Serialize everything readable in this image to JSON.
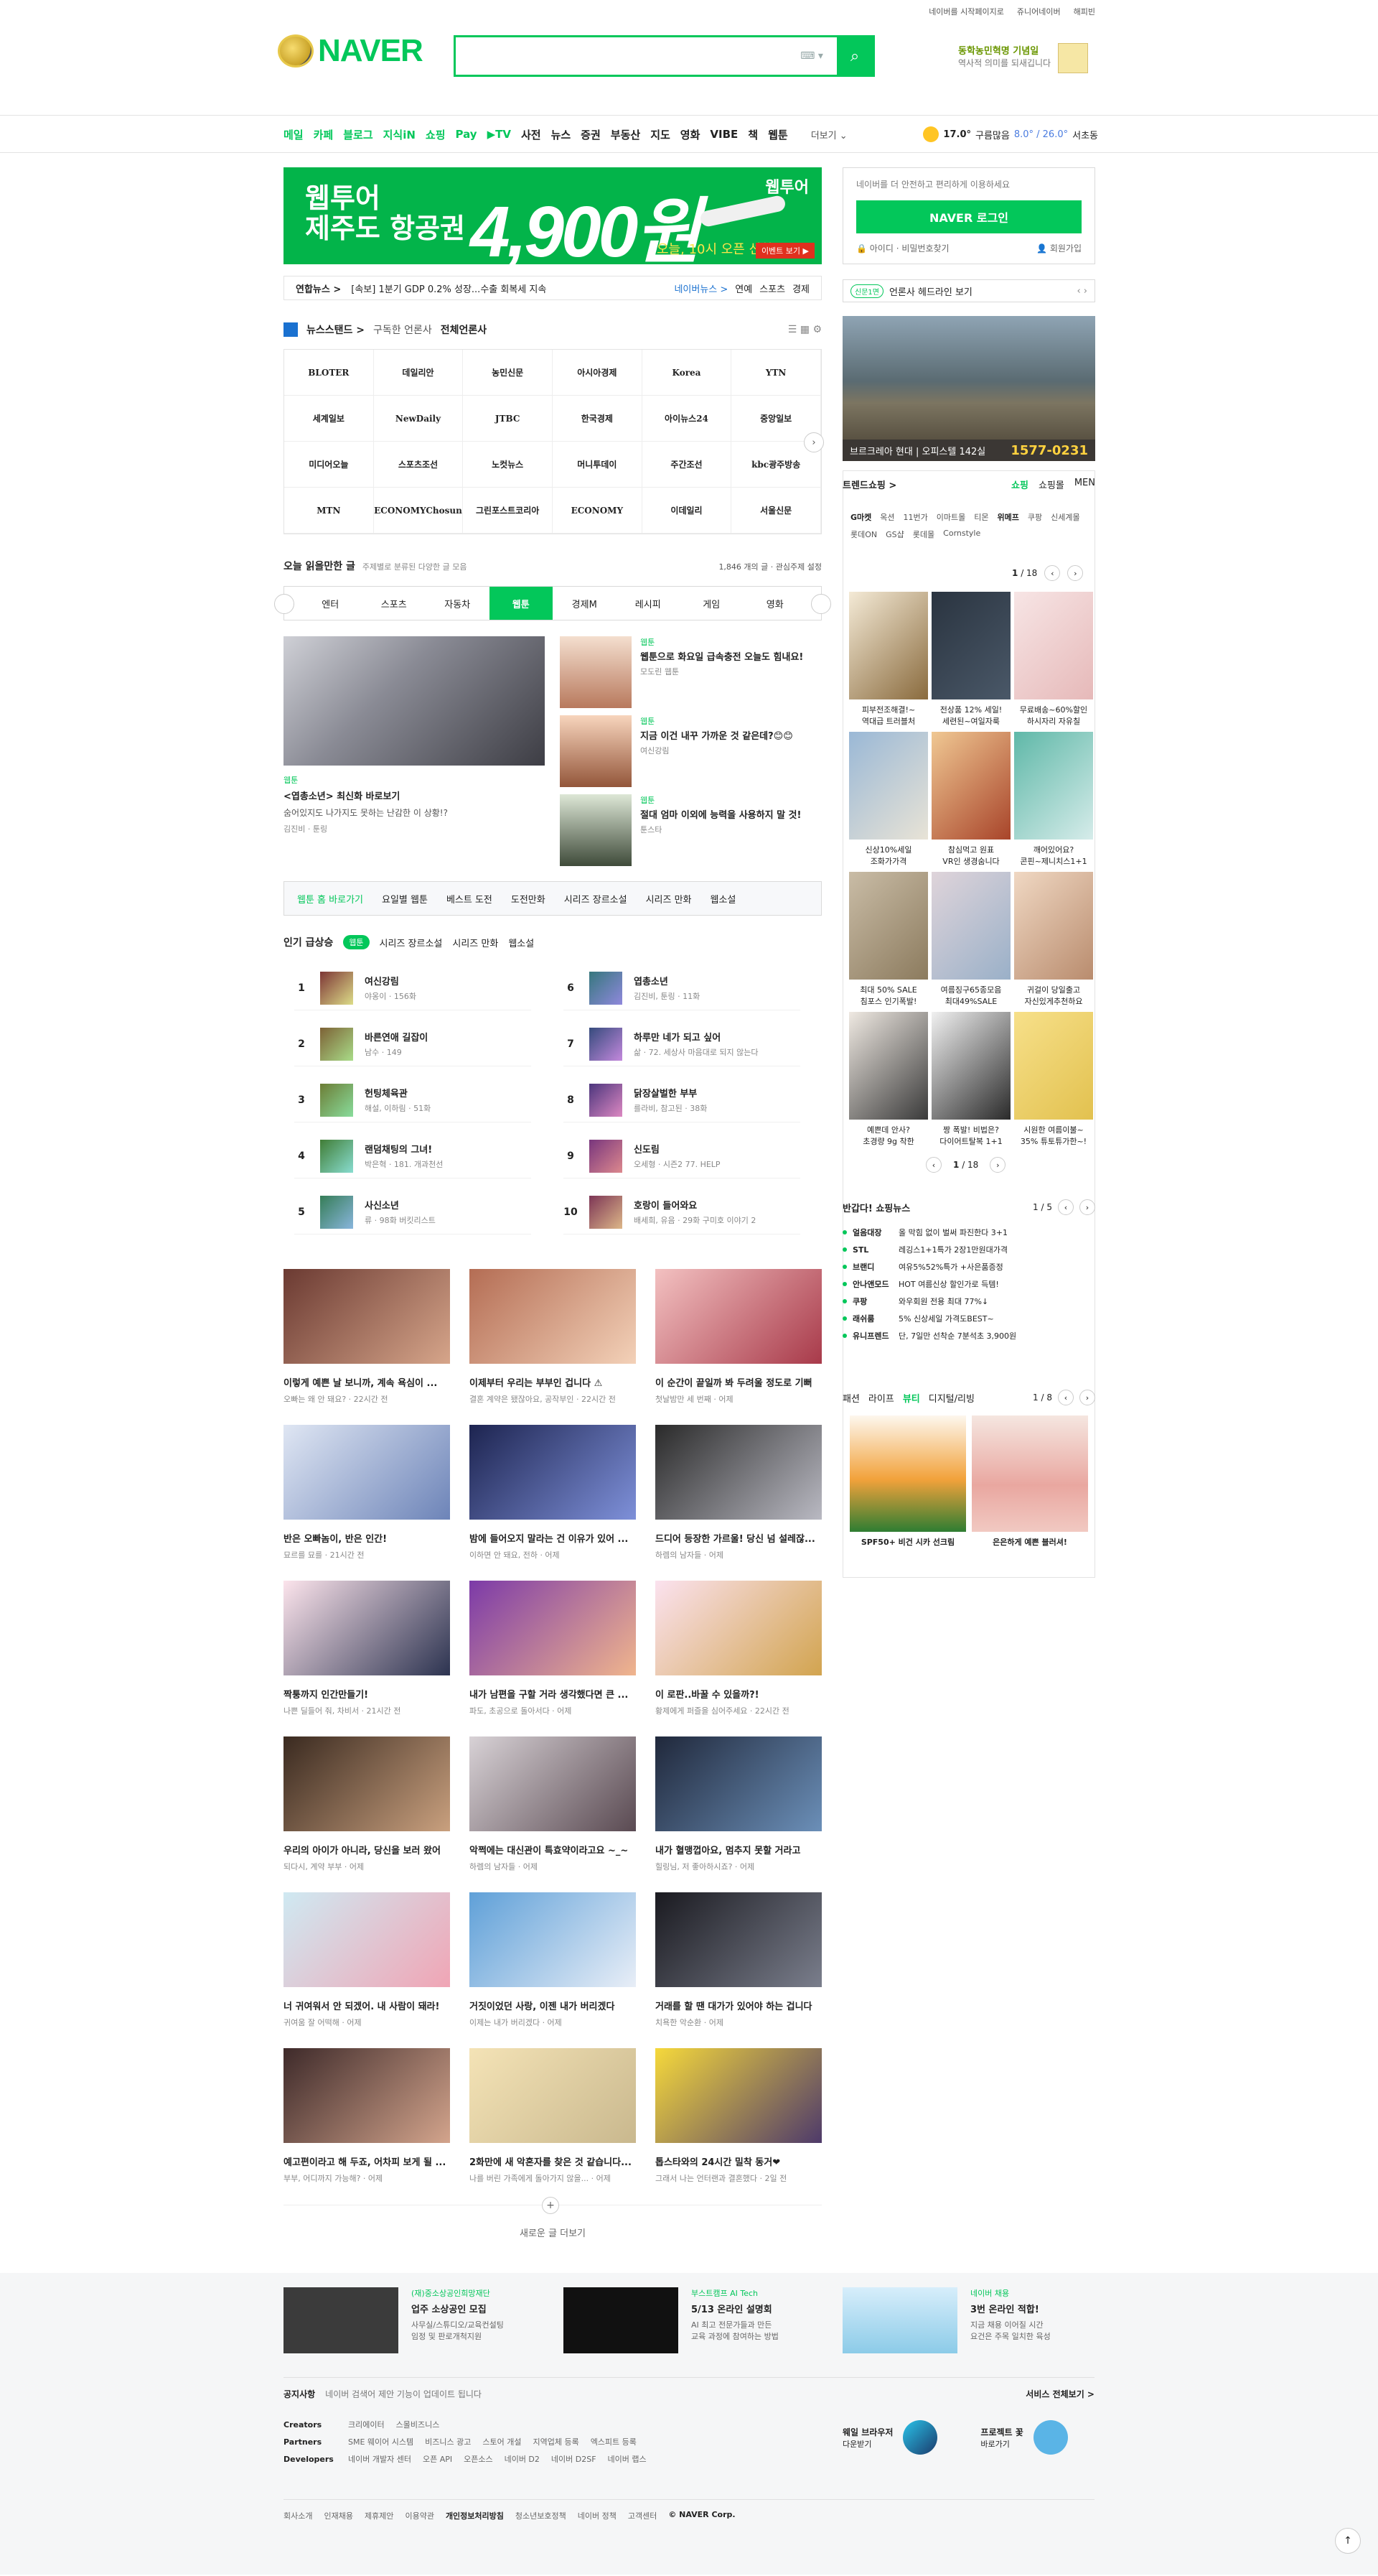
{
  "util": {
    "start": "네이버를 시작페이지로",
    "jr": "쥬니어네이버",
    "happy": "해피빈"
  },
  "logo": "NAVER",
  "search": {
    "placeholder": "",
    "kbd": "⌨ ▾"
  },
  "promo": {
    "line1": "동학농민혁명 기념일",
    "line2": "역사적 의미를 되새깁니다"
  },
  "gnb": {
    "items": [
      "메일",
      "카페",
      "블로그",
      "지식iN",
      "쇼핑",
      "Pay",
      "▶TV",
      "사전",
      "뉴스",
      "증권",
      "부동산",
      "지도",
      "영화",
      "VIBE",
      "책",
      "웹툰"
    ],
    "more": "더보기 ⌄",
    "weather": {
      "temp": "17.0°",
      "desc": "구름많음",
      "range": "8.0° / 26.0°",
      "loc": "서초동"
    }
  },
  "ad": {
    "line1": "웹투어",
    "line2": "제주도 항공권",
    "price": "4,900원",
    "brand": "웹투어",
    "sub": "오늘, 10시 오픈 선착순",
    "cta": "이벤트 보기 ▶"
  },
  "newsbar": {
    "src": "연합뉴스 >",
    "headline": "[속보] 1분기 GDP 0.2% 성장...수출 회복세 지속",
    "r1": "네이버뉴스 >",
    "r2": "연예",
    "r3": "스포츠",
    "r4": "경제"
  },
  "login": {
    "msg": "네이버를 더 안전하고 편리하게 이용하세요",
    "btn": "NAVER 로그인",
    "find": "🔒 아이디 · 비밀번호찾기",
    "join": "👤 회원가입"
  },
  "press": {
    "badge": "신문1면",
    "text": "언론사 헤드라인 보기",
    "arr": "‹  ›"
  },
  "newsstand": {
    "title": "뉴스스탠드 >",
    "sub1": "구독한 언론사",
    "sub2": "전체언론사",
    "tools": "☰  ▦  ⚙",
    "logos": [
      "BLOTER",
      "데일리안",
      "농민신문",
      "아시아경제",
      "Korea",
      "YTN",
      "세계일보",
      "NewDaily",
      "JTBC",
      "한국경제",
      "아이뉴스24",
      "중앙일보",
      "미디어오늘",
      "스포츠조선",
      "노컷뉴스",
      "머니투데이",
      "주간조선",
      "kbc광주방송",
      "MTN",
      "ECONOMYChosun",
      "그린포스트코리아",
      "ECONOMY",
      "이데일리",
      "서울신문"
    ]
  },
  "rec": {
    "title": "오늘 읽을만한 글",
    "sub": "주제별로 분류된 다양한 글 모음",
    "count": "1,846 개의 글",
    "set": "관심주제 설정"
  },
  "tabs": [
    "엔터",
    "스포츠",
    "자동차",
    "웹툰",
    "경제M",
    "레시피",
    "게임",
    "영화"
  ],
  "main": {
    "tag": "웹툰",
    "title": "<엽총소년> 최신화 바로보기",
    "desc": "숨어있지도 나가지도 못하는 난감한 이 상황!?",
    "author": "김진비 · 툰링"
  },
  "side": [
    {
      "tag": "웹툰",
      "title": "웹툰으로 화요일 급속충전 오늘도 힘내요!",
      "author": "모도린 웹툰"
    },
    {
      "tag": "웹툰",
      "title": "지금 이건 내꾸 가까운 것 같은데?😊😊",
      "author": "여신강림"
    },
    {
      "tag": "웹툰",
      "title": "절대 엄마 이외에 능력을 사용하지 말 것!",
      "author": "툰스타"
    }
  ],
  "webtoonTabs": [
    "웹툰 홈 바로가기",
    "요일별 웹툰",
    "베스트 도전",
    "도전만화",
    "시리즈 장르소설",
    "시리즈 만화",
    "웹소설"
  ],
  "pop": {
    "title": "인기 급상승",
    "tabs": [
      "웹툰",
      "시리즈 장르소설",
      "시리즈 만화",
      "웹소설"
    ]
  },
  "ranks": [
    {
      "n": "1",
      "t": "여신강림",
      "s": "야옹이 · 156화"
    },
    {
      "n": "2",
      "t": "바른연애 길잡이",
      "s": "남수 · 149"
    },
    {
      "n": "3",
      "t": "헌팅체육관",
      "s": "해설, 이하림 · 51화"
    },
    {
      "n": "4",
      "t": "랜덤채팅의 그녀!",
      "s": "박은혁 · 181. 개과천선"
    },
    {
      "n": "5",
      "t": "사신소년",
      "s": "류 · 98화 버킷리스트"
    },
    {
      "n": "6",
      "t": "엽총소년",
      "s": "김진비, 툰링 · 11화"
    },
    {
      "n": "7",
      "t": "하루만 네가 되고 싶어",
      "s": "삶 · 72. 세상사 마음대로 되지 않는다"
    },
    {
      "n": "8",
      "t": "닭장살벌한 부부",
      "s": "를라비, 참고된 · 38화"
    },
    {
      "n": "9",
      "t": "신도림",
      "s": "오세형 · 시즌2 77. HELP"
    },
    {
      "n": "10",
      "t": "호랑이 들어와요",
      "s": "배세희, 유음 · 29화 구미호 이야기 2"
    }
  ],
  "cards": [
    {
      "t": "이렇게 예쁜 날 보니까, 계속 욕심이 ...",
      "s": "오빠는 왜 안 돼요? · 22시간 전"
    },
    {
      "t": "이제부터 우리는 부부인 겁니다 ⚠",
      "s": "결혼 계약은 됐잖아요, 공작부인 · 22시간 전"
    },
    {
      "t": "이 순간이 끝일까 봐 두려울 정도로 기뻐",
      "s": "첫날밤만 세 번째 · 어제"
    },
    {
      "t": "반은 오빠놈이, 반은 인간!",
      "s": "묘르를 묘를 · 21시간 전"
    },
    {
      "t": "밤에 들어오지 말라는 건 이유가 있어 ...",
      "s": "이하면 안 돼요, 전하 · 어제"
    },
    {
      "t": "드디어 등장한 가르울! 당신 넘 설레잖...",
      "s": "하렘의 남자들 · 어제"
    },
    {
      "t": "짝퉁까지 인간만들기!",
      "s": "나쁜 딜들어 줘, 차비서 · 21시간 전"
    },
    {
      "t": "내가 남편을 구할 거라 생각했다면 큰 ...",
      "s": "파도, 초공으로 돌아서다 · 어제"
    },
    {
      "t": "이 로판..바꿀 수 있을까?!",
      "s": "황제에게 퍼즐을 심어주세요 · 22시간 전"
    },
    {
      "t": "우리의 아이가 아니라, 당신을 보러 왔어",
      "s": "되다시, 계약 부부 · 어제"
    },
    {
      "t": "악쩍에는 대신관이 특효약이라고요 ~_~",
      "s": "하렘의 남자들 · 어제"
    },
    {
      "t": "내가 혈맹껍아요, 멈추지 못할 거라고",
      "s": "힐링님, 저 좋아하시죠? · 어제"
    },
    {
      "t": "너 귀여워서 안 되겠어. 내 사람이 돼라!",
      "s": "귀여움 잘 어떡해 · 어제"
    },
    {
      "t": "거짓이었던 사랑, 이젠 내가 버리겠다",
      "s": "이제는 내가 버리겠다 · 어제"
    },
    {
      "t": "거래를 할 땐 대가가 있어야 하는 겁니다",
      "s": "치욕한 악순환 · 어제"
    },
    {
      "t": "예고편이라고 해 두죠, 어차피 보게 될 ...",
      "s": "부부, 어디까지 가능해? · 어제"
    },
    {
      "t": "2화만에 새 악혼자를 찾은 것 같습니다...",
      "s": "나를 버린 가족에게 돌아가지 않을... · 어제"
    },
    {
      "t": "톱스타와의 24시간 밀착 동거❤",
      "s": "그래서 나는 언터랜과 결혼했다 · 2일 전"
    }
  ],
  "more": "새로운 글 더보기",
  "photoAd": {
    "name": "브르크레아 현대 | 오피스텔 142실",
    "phone": "1577-0231"
  },
  "trend": {
    "title": "트렌드쇼핑 >",
    "tabs": [
      "쇼핑",
      "쇼핑몰",
      "MEN"
    ],
    "kw": [
      "G마켓",
      "옥션",
      "11번가",
      "이마트몰",
      "티몬",
      "위메프",
      "쿠팡",
      "신세계몰",
      "롯데ON",
      "GS샵",
      "롯데몰",
      "Cornstyle"
    ]
  },
  "pager1": {
    "cur": "1",
    "total": "/ 18"
  },
  "prods": [
    "피부전조해결!~",
    "전상품 12% 세일!",
    "무료배송~60%할인",
    "신상10%세일",
    "참심먹고 원표",
    "깨어있어요?",
    "최대 50% SALE",
    "여름징구65종모음",
    "귀걸이 당일출고",
    "예쁜데 안사?",
    "짱 폭발! 비법은?",
    "시원한 여름이불~"
  ],
  "prods2": [
    "역대급 트러블처",
    "세련된~여일자룩",
    "하시자리 자유칠",
    "조화가가격",
    "VR인 생경숨니다",
    "콘핀~제니치스1+1",
    "침포스 인기폭발!",
    "최대49%SALE",
    "자신있게추천하요",
    "초경량 9g 착한",
    "다이어트탈복 1+1",
    "35% 튜토튜가한~!"
  ],
  "pager2": {
    "cur": "1",
    "total": "/ 18"
  },
  "shopNews": {
    "title": "반갑다! 쇼핑뉴스",
    "pg": "1 / 5",
    "items": [
      {
        "k": "얼음대장",
        "v": "올 막힘 없이 벌써 파진한다 3+1"
      },
      {
        "k": "STL",
        "v": "레깅스1+1특가 2장1만원대가격"
      },
      {
        "k": "브랜디",
        "v": "여유5%52%특가 +사은품증정"
      },
      {
        "k": "안나앤모드",
        "v": "HOT 여름신상 할인가로 득템!"
      },
      {
        "k": "쿠팡",
        "v": "와우회원 전용 최대 77%↓"
      },
      {
        "k": "래쉬룸",
        "v": "5% 신상세일 가격도BEST~"
      },
      {
        "k": "유니프렌드",
        "v": "단, 7일만 선착순 7분석초 3,900원"
      }
    ]
  },
  "fashion": {
    "tabs": [
      "패션",
      "라이프",
      "뷰티",
      "디지털/리빙"
    ],
    "pg": "1 / 8",
    "items": [
      {
        "t": "SPF50+ 비건 시카 선크림"
      },
      {
        "t": "은은하게 예쁜 블러셔!"
      }
    ]
  },
  "footerAds": [
    {
      "tag": "(재)중소상공인희망재단",
      "t": "업주 소상공인 모집",
      "d": "사무실/스튜디오/교육컨설팅\n임정 및 판로개척지원"
    },
    {
      "tag": "부스트캠프 AI Tech",
      "t": "5/13 온라인 설명회",
      "d": "AI 최고 전문가들과 만든\n교육 과정에 참여하는 방법"
    },
    {
      "tag": "네이버 채용",
      "t": "3번 온라인 적합!",
      "d": "지금 채용 이어질 시간\n요건은 주목 일치한 육성"
    }
  ],
  "notice": {
    "title": "공지사항",
    "text": "네이버 검색어 제안 기능이 업데이트 됩니다",
    "right": "서비스 전체보기 >"
  },
  "links": [
    {
      "k": "Creators",
      "v": [
        "크리에이터",
        "스몰비즈니스"
      ]
    },
    {
      "k": "Partners",
      "v": [
        "SME 웨이어 시스템",
        "비즈니스 광고",
        "스토어 개설",
        "지역업체 등록",
        "엑스피트 등록"
      ]
    },
    {
      "k": "Developers",
      "v": [
        "네이버 개발자 센터",
        "오픈 API",
        "오픈소스",
        "네이버 D2",
        "네이버 D2SF",
        "네이버 랩스"
      ]
    }
  ],
  "apps": [
    {
      "b": "웨일 브라우저",
      "s": "다운받기"
    },
    {
      "b": "프로젝트 꽃",
      "s": "바로가기"
    }
  ],
  "bottom": [
    "회사소개",
    "인재채용",
    "제휴제안",
    "이용약관",
    "개인정보처리방침",
    "청소년보호정책",
    "네이버 정책",
    "고객센터",
    "© NAVER Corp."
  ],
  "topBtn": "↑"
}
